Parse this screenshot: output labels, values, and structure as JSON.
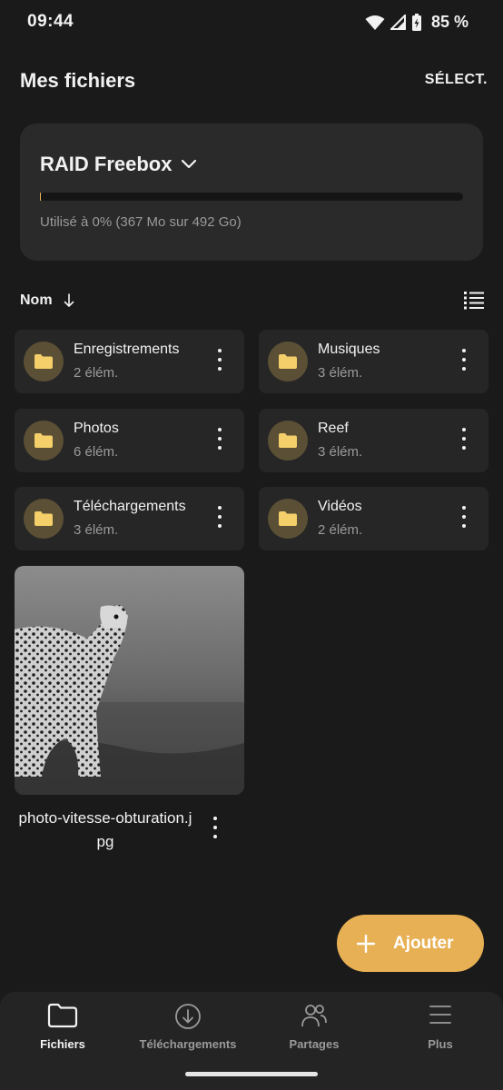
{
  "status": {
    "time": "09:44",
    "battery": "85 %"
  },
  "header": {
    "title": "Mes fichiers",
    "select_label": "SÉLECT."
  },
  "storage": {
    "name": "RAID Freebox",
    "usage_text": "Utilisé à 0% (367 Mo sur 492 Go)",
    "usage_fraction": 0.0007,
    "accent": "#e8b055"
  },
  "sort": {
    "label": "Nom"
  },
  "folders": [
    {
      "name": "Enregistrements",
      "count": "2 élém."
    },
    {
      "name": "Musiques",
      "count": "3 élém."
    },
    {
      "name": "Photos",
      "count": "6 élém."
    },
    {
      "name": "Reef",
      "count": "3 élém."
    },
    {
      "name": "Téléchargements",
      "count": "3 élém."
    },
    {
      "name": "Vidéos",
      "count": "2 élém."
    }
  ],
  "file": {
    "name": "photo-vitesse-obturation.jpg"
  },
  "fab": {
    "label": "Ajouter"
  },
  "nav": [
    {
      "label": "Fichiers",
      "icon": "folder-icon",
      "active": true
    },
    {
      "label": "Téléchargements",
      "icon": "download-icon",
      "active": false
    },
    {
      "label": "Partages",
      "icon": "people-icon",
      "active": false
    },
    {
      "label": "Plus",
      "icon": "menu-icon",
      "active": false
    }
  ],
  "colors": {
    "background": "#1a1a1a",
    "card": "#262626",
    "folder": "#f4cf6a"
  }
}
